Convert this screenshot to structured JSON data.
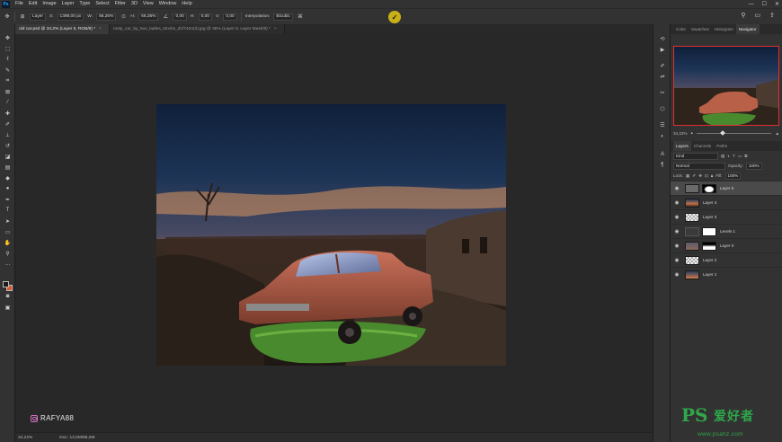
{
  "menubar": {
    "logo": "Ps",
    "items": [
      "File",
      "Edit",
      "Image",
      "Layer",
      "Type",
      "Select",
      "Filter",
      "3D",
      "View",
      "Window",
      "Help"
    ],
    "window_controls": [
      "—",
      "☐",
      "✕"
    ]
  },
  "options": {
    "ref_label": "X:",
    "x_value": "1398,00 px",
    "w_label": "W:",
    "w_value": "66,26%",
    "h_label": "H:",
    "h_value": "66,26%",
    "angle_value": "0,00",
    "hskew_label": "H:",
    "hskew_value": "0,00",
    "vskew_label": "V:",
    "vskew_value": "0,00",
    "interp_label": "Interpolation:",
    "interp_value": "Bicubic",
    "layer_label": "Layer"
  },
  "tabs": [
    {
      "label": "old car.psd @ 34,2% (Layer 5, RGB/8) *",
      "active": true
    },
    {
      "label": "rusty_car_by_two_ladies_stocks_d1f742o(2).jpg @ 36% (Layer 0, Layer Mask/8) *",
      "active": false
    }
  ],
  "canvas": {
    "author": "RAFYA88"
  },
  "status": {
    "zoom": "34,22%",
    "doc": "Doc: 13,0M/86,0M"
  },
  "panels": {
    "top_tabs": [
      "Color",
      "Swatches",
      "Histogram",
      "Navigator"
    ],
    "active_top_tab": "Navigator",
    "nav_zoom": "34,22%",
    "layer_tabs": [
      "Layers",
      "Channels",
      "Paths"
    ],
    "filter_placeholder": "Kind",
    "blend_mode": "Normal",
    "opacity_label": "Opacity:",
    "opacity_value": "100%",
    "lock_label": "Lock:",
    "fill_label": "Fill:",
    "fill_value": "100%",
    "layers": [
      {
        "name": "Layer 5",
        "selected": true,
        "mask": true,
        "adjust": false
      },
      {
        "name": "Layer 4",
        "selected": false,
        "mask": false,
        "adjust": false
      },
      {
        "name": "Layer 3",
        "selected": false,
        "mask": false,
        "adjust": false
      },
      {
        "name": "Levels 1",
        "selected": false,
        "mask": true,
        "adjust": true
      },
      {
        "name": "Layer 0",
        "selected": false,
        "mask": true,
        "adjust": false
      },
      {
        "name": "Layer 2",
        "selected": false,
        "mask": false,
        "adjust": false
      },
      {
        "name": "Layer 1",
        "selected": false,
        "mask": false,
        "adjust": false
      }
    ]
  },
  "site_watermark": {
    "ps": "PS",
    "cn": "爱好者",
    "url": "www.psahz.com"
  }
}
